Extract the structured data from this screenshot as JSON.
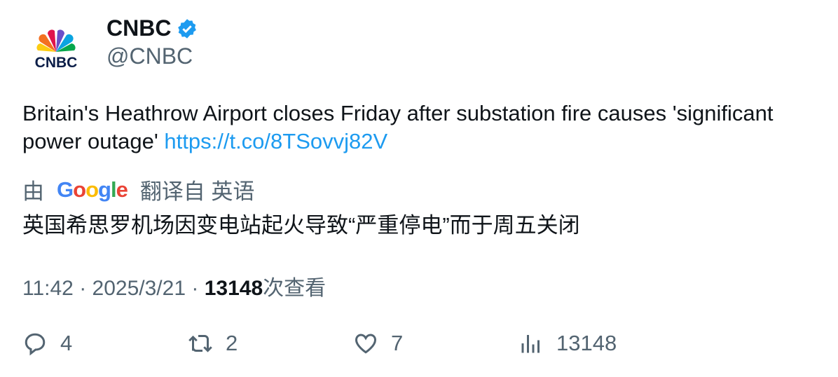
{
  "author": {
    "name": "CNBC",
    "handle": "@CNBC",
    "verified": true,
    "logo_text": "CNBC"
  },
  "tweet": {
    "text": "Britain's Heathrow Airport closes Friday after substation fire causes 'significant power outage' ",
    "link": "https://t.co/8TSovvj82V"
  },
  "translation": {
    "by": "由",
    "brand": "Google",
    "from": "翻译自 英语",
    "text": "英国希思罗机场因变电站起火导致“严重停电”而于周五关闭"
  },
  "meta": {
    "time": "11:42",
    "date": "2025/3/21",
    "views": "13148",
    "views_label": "次查看",
    "sep": "·"
  },
  "actions": {
    "replies": "4",
    "retweets": "2",
    "likes": "7",
    "views": "13148"
  },
  "colors": {
    "link": "#1d9bf0",
    "muted": "#536471",
    "verified": "#1d9bf0"
  }
}
